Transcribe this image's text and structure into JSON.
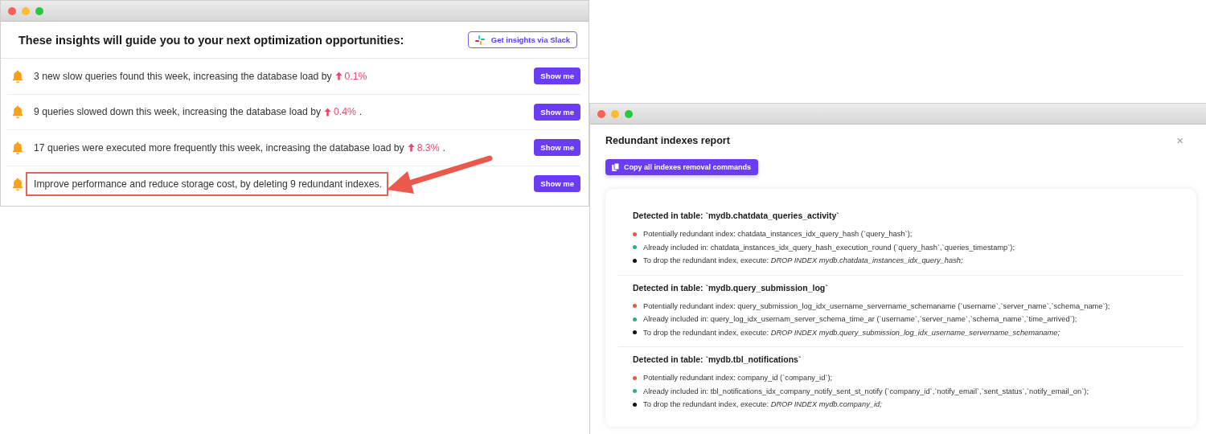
{
  "insights_window": {
    "heading": "These insights will guide you to your next optimization opportunities:",
    "slack_button": "Get insights via Slack",
    "insights": [
      {
        "text": "3 new slow queries found this week, increasing the database load by",
        "change": "0.1%",
        "highlighted": false,
        "button": "Show me"
      },
      {
        "text": "9 queries slowed down this week, increasing the database load by",
        "change": "0.4%",
        "suffix": ".",
        "highlighted": false,
        "button": "Show me"
      },
      {
        "text": "17 queries were executed more frequently this week, increasing the database load by",
        "change": "8.3%",
        "suffix": ".",
        "highlighted": false,
        "button": "Show me"
      },
      {
        "text": "Improve performance and reduce storage cost, by deleting 9 redundant indexes.",
        "highlighted": true,
        "button": "Show me"
      }
    ]
  },
  "report_window": {
    "title": "Redundant indexes report",
    "close": "×",
    "copy_button": "Copy all indexes removal commands",
    "sections": [
      {
        "heading": "Detected in table: `mydb.chatdata_queries_activity`",
        "items": [
          {
            "text": "Potentially redundant index: chatdata_instances_idx_query_hash (`query_hash`);",
            "color": "#f0563c"
          },
          {
            "text": "Already included in: chatdata_instances_idx_query_hash_execution_round (`query_hash`,`queries_timestamp`);",
            "color": "#22b573"
          },
          {
            "text": "To drop the redundant index, execute: *DROP INDEX mydb.chatdata_instances_idx_query_hash;*",
            "color": "#111111"
          }
        ]
      },
      {
        "heading": "Detected in table: `mydb.query_submission_log`",
        "items": [
          {
            "text": "Potentially redundant index: query_submission_log_idx_username_servername_schemaname (`username`,`server_name`,`schema_name`);",
            "color": "#f0563c"
          },
          {
            "text": "Already included in: query_log_idx_usernam_server_schema_time_ar (`username`,`server_name`,`schema_name`,`time_arrived`);",
            "color": "#22b573"
          },
          {
            "text": "To drop the redundant index, execute: *DROP INDEX mydb.query_submission_log_idx_username_servername_schemaname;*",
            "color": "#111111"
          }
        ]
      },
      {
        "heading": "Detected in table: `mydb.tbl_notifications`",
        "items": [
          {
            "text": "Potentially redundant index: company_id (`company_id`);",
            "color": "#f0563c"
          },
          {
            "text": "Already included in: tbl_notifications_idx_company_notify_sent_st_notify (`company_id`,`notify_email`,`sent_status`,`notify_email_on`);",
            "color": "#22b573"
          },
          {
            "text": "To drop the redundant index, execute: *DROP INDEX mydb.company_id;*",
            "color": "#111111"
          }
        ]
      }
    ]
  }
}
